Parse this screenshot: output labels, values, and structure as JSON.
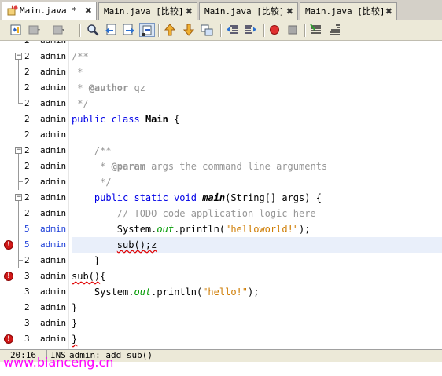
{
  "tabs": [
    {
      "label": "Main.java *",
      "close": "✖"
    },
    {
      "label": "Main.java [比较]",
      "close": "✖"
    },
    {
      "label": "Main.java [比较]",
      "close": "✖"
    },
    {
      "label": "Main.java [比较]",
      "close": "✖"
    }
  ],
  "toolbar": {
    "buttons": [
      "toggle-annotations-icon",
      "back-icon",
      "forward-icon",
      "find-icon",
      "find-previous-icon",
      "find-next-icon",
      "toggle-highlight-icon",
      "previous-bookmark-icon",
      "next-bookmark-icon",
      "toggle-bookmark-icon",
      "shift-left-icon",
      "shift-right-icon",
      "start-macro-icon",
      "stop-macro-icon",
      "comment-icon",
      "uncomment-icon"
    ]
  },
  "editor": {
    "lines": [
      {
        "rev": "2",
        "user": "admin"
      },
      {
        "rev": "2",
        "user": "admin"
      },
      {
        "rev": "2",
        "user": "admin"
      },
      {
        "rev": "2",
        "user": "admin"
      },
      {
        "rev": "2",
        "user": "admin"
      },
      {
        "rev": "2",
        "user": "admin"
      },
      {
        "rev": "2",
        "user": "admin"
      },
      {
        "rev": "2",
        "user": "admin"
      },
      {
        "rev": "2",
        "user": "admin"
      },
      {
        "rev": "2",
        "user": "admin"
      },
      {
        "rev": "2",
        "user": "admin"
      },
      {
        "rev": "2",
        "user": "admin"
      },
      {
        "rev": "5",
        "user": "admin"
      },
      {
        "rev": "5",
        "user": "admin"
      },
      {
        "rev": "2",
        "user": "admin"
      },
      {
        "rev": "3",
        "user": "admin"
      },
      {
        "rev": "3",
        "user": "admin"
      },
      {
        "rev": "2",
        "user": "admin"
      },
      {
        "rev": "3",
        "user": "admin"
      },
      {
        "rev": "3",
        "user": "admin"
      }
    ],
    "code": {
      "l1_open": "/**",
      "l2": " *",
      "l3_prefix": " * ",
      "l3_tag": "@author",
      "l3_rest": " qz",
      "l4": " */",
      "l5_kw": "public class",
      "l5_name": "Main",
      "l5_rest": " {",
      "l7": "    /**",
      "l8_prefix": "     * ",
      "l8_tag": "@param",
      "l8_rest": " args the command line arguments",
      "l9": "     */",
      "l10_indent": "    ",
      "l10_kw": "public static void",
      "l10_name": "main",
      "l10_rest": "(String[] args) {",
      "l11": "        // TODO code application logic here",
      "l12_pre": "        System.",
      "l12_fld": "out",
      "l12_mid": ".println(",
      "l12_str": "\"helloworld!\"",
      "l12_end": ");",
      "l13_indent": "        ",
      "l13_call": "sub()",
      "l13_rest": ";z",
      "l14": "    }",
      "l15_call": "sub()",
      "l15_rest": "{",
      "l16_pre": "    System.",
      "l16_fld": "out",
      "l16_mid": ".println(",
      "l16_str": "\"hello!\"",
      "l16_end": ");",
      "l17": "}",
      "l18": "}",
      "l19": "}"
    }
  },
  "status": {
    "position": "20:16",
    "mode": "INS",
    "message": "admin: add sub()"
  },
  "watermark": "www.bianceng.cn"
}
